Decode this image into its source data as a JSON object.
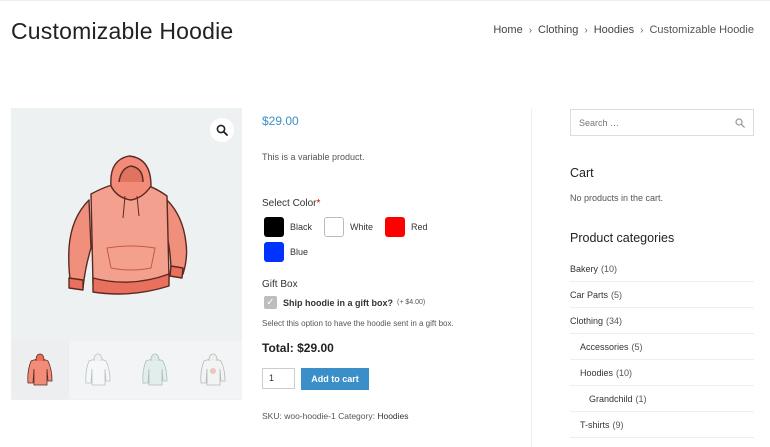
{
  "page": {
    "title": "Customizable Hoodie"
  },
  "breadcrumb": {
    "items": [
      "Home",
      "Clothing",
      "Hoodies"
    ],
    "separator": "›",
    "current": "Customizable Hoodie"
  },
  "product": {
    "price": "$29.00",
    "short_description": "This is a variable product.",
    "color_label": "Select Color",
    "required_mark": "*",
    "colors": [
      {
        "name": "Black",
        "hex": "#000000"
      },
      {
        "name": "White",
        "hex": "#ffffff"
      },
      {
        "name": "Red",
        "hex": "#ff0000"
      },
      {
        "name": "Blue",
        "hex": "#0033ff"
      }
    ],
    "gift_label": "Gift Box",
    "gift_option": "Ship hoodie in a gift box?",
    "gift_price": "(+ $4.00)",
    "gift_help": "Select this option to have the hoodie sent in a gift box.",
    "total": "Total: $29.00",
    "quantity": "1",
    "add_to_cart": "Add to cart",
    "meta_sku": "SKU: woo-hoodie-1",
    "meta_category_label": "Category:",
    "meta_category": "Hoodies"
  },
  "sidebar": {
    "search_placeholder": "Search …",
    "cart_title": "Cart",
    "cart_empty": "No products in the cart.",
    "categories_title": "Product categories",
    "categories": [
      {
        "name": "Bakery",
        "count": "(10)",
        "level": 0
      },
      {
        "name": "Car Parts",
        "count": "(5)",
        "level": 0
      },
      {
        "name": "Clothing",
        "count": "(34)",
        "level": 0
      },
      {
        "name": "Accessories",
        "count": "(5)",
        "level": 1
      },
      {
        "name": "Hoodies",
        "count": "(10)",
        "level": 1
      },
      {
        "name": "Grandchild",
        "count": "(1)",
        "level": 2
      },
      {
        "name": "T-shirts",
        "count": "(9)",
        "level": 1
      }
    ]
  },
  "colors": {
    "accent": "#3a8fc9",
    "hoodie": "#f28b78"
  }
}
